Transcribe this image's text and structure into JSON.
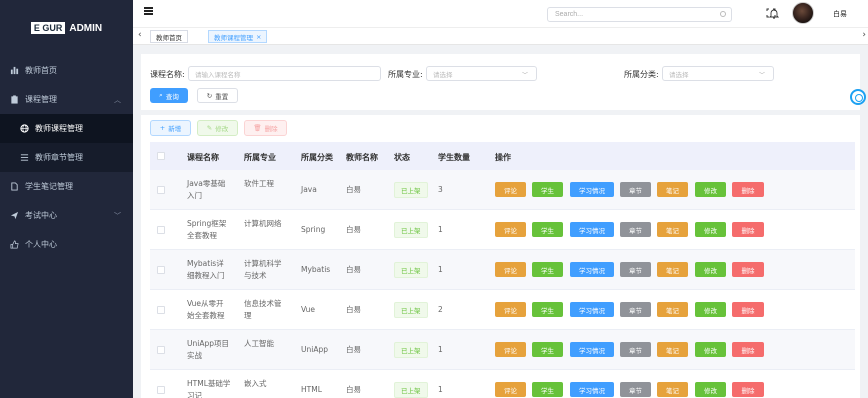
{
  "logo": {
    "box": "E GUR",
    "text": "ADMIN"
  },
  "sidebar": {
    "items": [
      {
        "label": "教师首页",
        "icon": "bar-chart-icon"
      },
      {
        "label": "课程管理",
        "icon": "clipboard-icon",
        "arrow": "^"
      },
      {
        "label": "教师课程管理",
        "icon": "globe-icon"
      },
      {
        "label": "教师章节管理",
        "icon": "list-icon"
      },
      {
        "label": "学生笔记管理",
        "icon": "document-icon"
      },
      {
        "label": "考试中心",
        "icon": "send-icon",
        "arrow": "v"
      },
      {
        "label": "个人中心",
        "icon": "thumbs-up-icon"
      }
    ]
  },
  "topbar": {
    "search_placeholder": "Search...",
    "username": "白易"
  },
  "tabs": [
    {
      "label": "教师首页"
    },
    {
      "label": "教师课程管理",
      "close": "×"
    }
  ],
  "filter": {
    "name_label": "课程名称:",
    "name_placeholder": "请输入课程名称",
    "major_label": "所属专业:",
    "major_placeholder": "请选择",
    "category_label": "所属分类:",
    "category_placeholder": "请选择",
    "query_label": "查询",
    "reset_label": "重置"
  },
  "actions": {
    "add": "新增",
    "edit": "修改",
    "delete": "删除"
  },
  "table": {
    "headers": [
      "课程名称",
      "所属专业",
      "所属分类",
      "教师名称",
      "状态",
      "学生数量",
      "操作"
    ],
    "op_buttons": [
      "评论",
      "学生",
      "学习情况",
      "章节",
      "笔记",
      "修改",
      "删除"
    ],
    "rows": [
      {
        "name1": "Java零基础",
        "name2": "入门",
        "major1": "软件工程",
        "major2": "",
        "category": "Java",
        "teacher": "白易",
        "status": "已上架",
        "count": "3"
      },
      {
        "name1": "Spring框架",
        "name2": "全套教程",
        "major1": "计算机网络",
        "major2": "",
        "category": "Spring",
        "teacher": "白易",
        "status": "已上架",
        "count": "1"
      },
      {
        "name1": "Mybatis详",
        "name2": "细教程入门",
        "major1": "计算机科学",
        "major2": "与技术",
        "category": "Mybatis",
        "teacher": "白易",
        "status": "已上架",
        "count": "1"
      },
      {
        "name1": "Vue从零开",
        "name2": "始全套教程",
        "major1": "信息技术管",
        "major2": "理",
        "category": "Vue",
        "teacher": "白易",
        "status": "已上架",
        "count": "2"
      },
      {
        "name1": "UniApp项目",
        "name2": "实战",
        "major1": "人工智能",
        "major2": "",
        "category": "UniApp",
        "teacher": "白易",
        "status": "已上架",
        "count": "1"
      },
      {
        "name1": "HTML基础学",
        "name2": "习记",
        "major1": "嵌入式",
        "major2": "",
        "category": "HTML",
        "teacher": "白易",
        "status": "已上架",
        "count": "1"
      }
    ]
  },
  "colors": {
    "sidebar": "#21273a",
    "primary": "#409eff",
    "success": "#67c23a",
    "warning": "#e6a23c",
    "danger": "#f56c6c",
    "info": "#909399"
  }
}
